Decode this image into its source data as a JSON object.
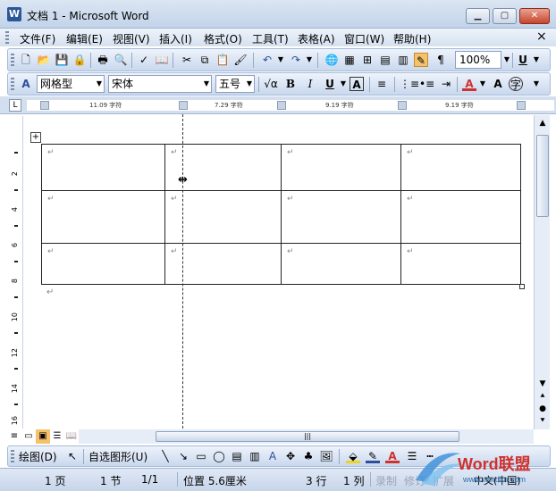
{
  "window": {
    "title": "文档 1 - Microsoft Word"
  },
  "menu": {
    "items": [
      "文件(F)",
      "编辑(E)",
      "视图(V)",
      "插入(I)",
      "格式(O)",
      "工具(T)",
      "表格(A)",
      "窗口(W)",
      "帮助(H)"
    ]
  },
  "standard_toolbar": {
    "zoom": "100%"
  },
  "format_toolbar": {
    "style": "网格型",
    "font": "宋体",
    "size": "五号"
  },
  "ruler": {
    "columns": [
      "11.09 字符",
      "7.29 字符",
      "9.19 字符",
      "9.19 字符"
    ]
  },
  "vertical_ruler": {
    "numbers": [
      "2",
      "4",
      "6",
      "8",
      "10",
      "12",
      "14",
      "16"
    ]
  },
  "table": {
    "rows": 3,
    "cols": 4,
    "cell_mark": "↵"
  },
  "drawing_toolbar": {
    "draw_label": "绘图(D)",
    "autoshapes_label": "自选图形(U)"
  },
  "status": {
    "page": "1 页",
    "section": "1 节",
    "pages": "1/1",
    "position": "位置 5.6厘米",
    "line": "3 行",
    "column": "1 列",
    "rec": "录制",
    "trk": "修订",
    "ext": "扩展",
    "lang": "中文(中国)"
  },
  "watermark": {
    "brand": "Word联盟",
    "url": "www.wordlm.com"
  },
  "colors": {
    "accent": "#2b5797",
    "highlight_red": "#d0312d"
  }
}
